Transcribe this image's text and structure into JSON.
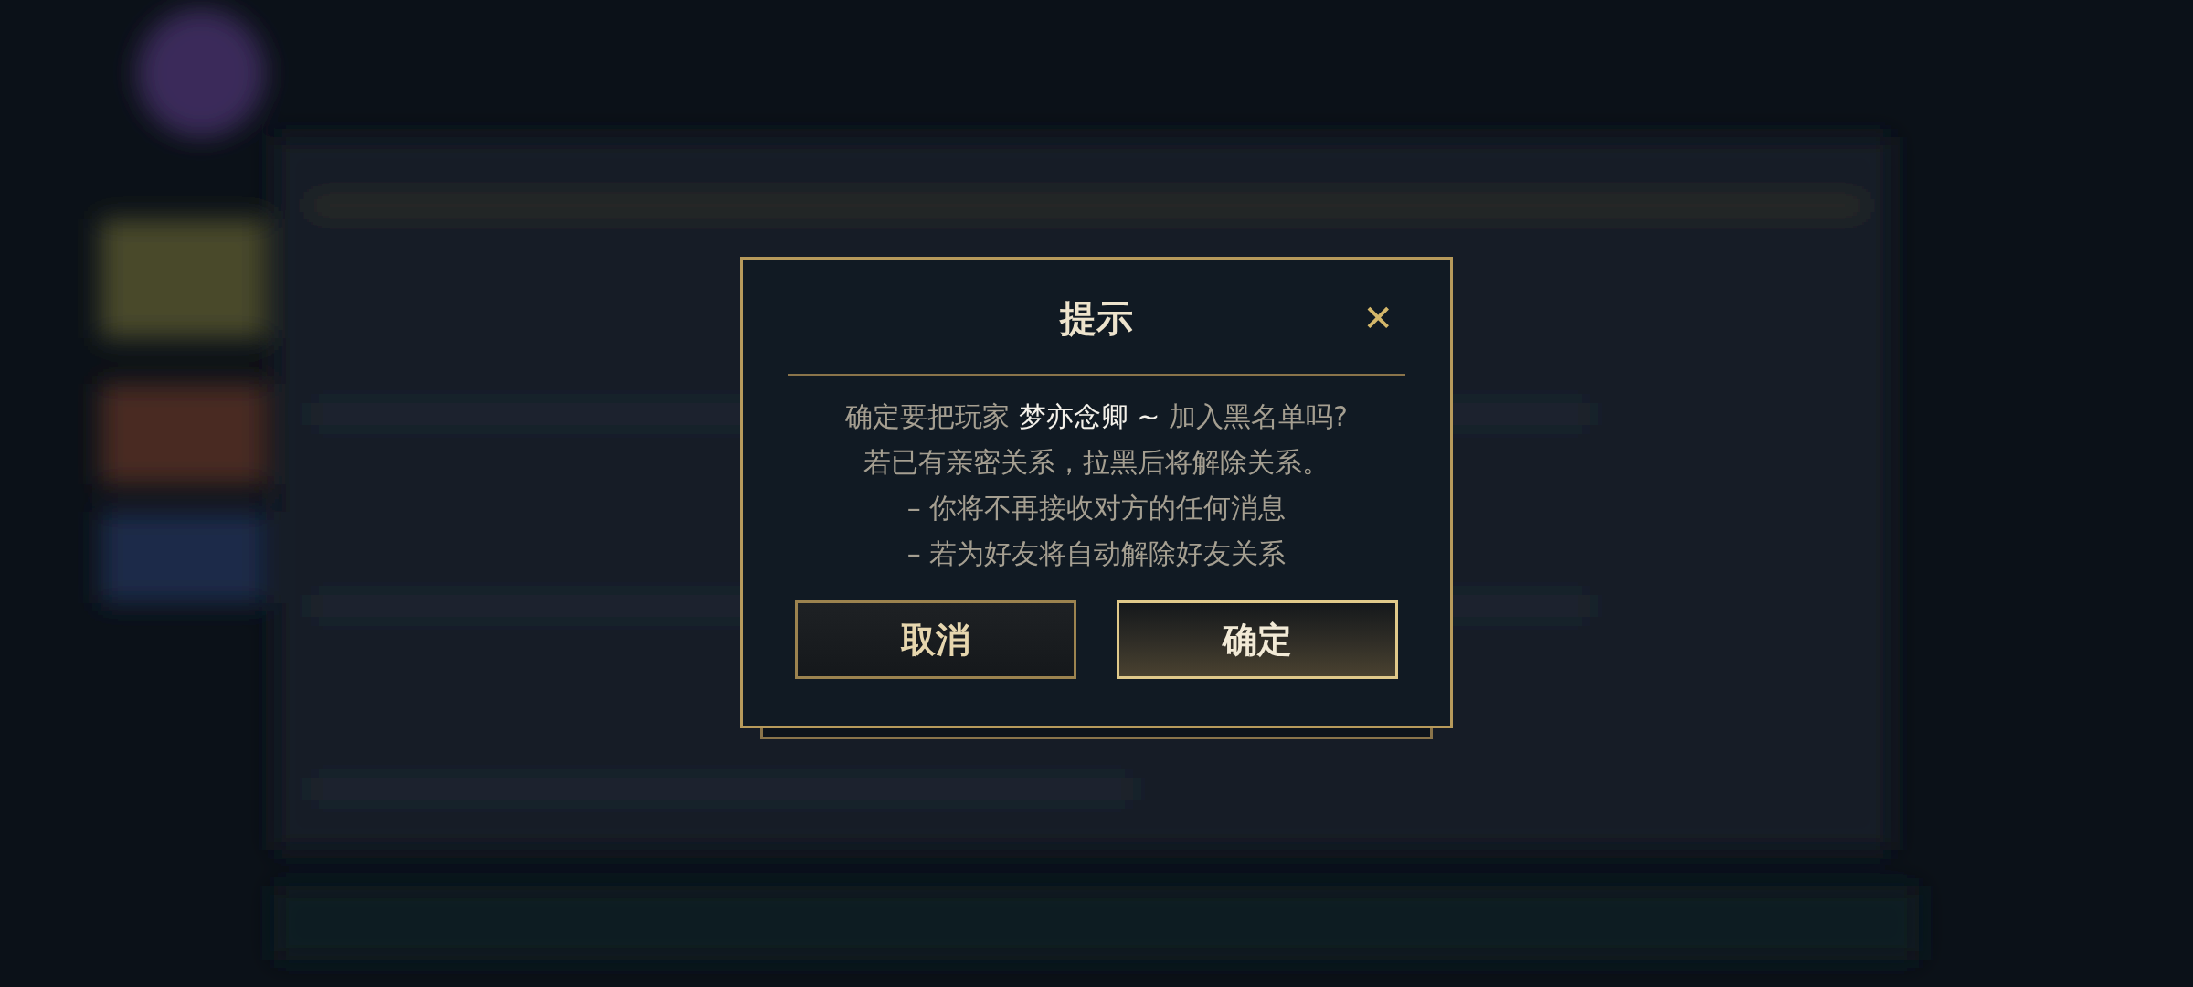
{
  "dialog": {
    "title": "提示",
    "close_symbol": "✕",
    "message": {
      "before": "确定要把玩家 ",
      "player_name": "梦亦念卿 ~",
      "after": " 加入黑名单吗?"
    },
    "lines": [
      "若已有亲密关系，拉黑后将解除关系。",
      "– 你将不再接收对方的任何消息",
      "– 若为好友将自动解除好友关系"
    ],
    "buttons": [
      {
        "label": "取消",
        "kind": "secondary"
      },
      {
        "label": "确定",
        "kind": "primary"
      }
    ]
  }
}
